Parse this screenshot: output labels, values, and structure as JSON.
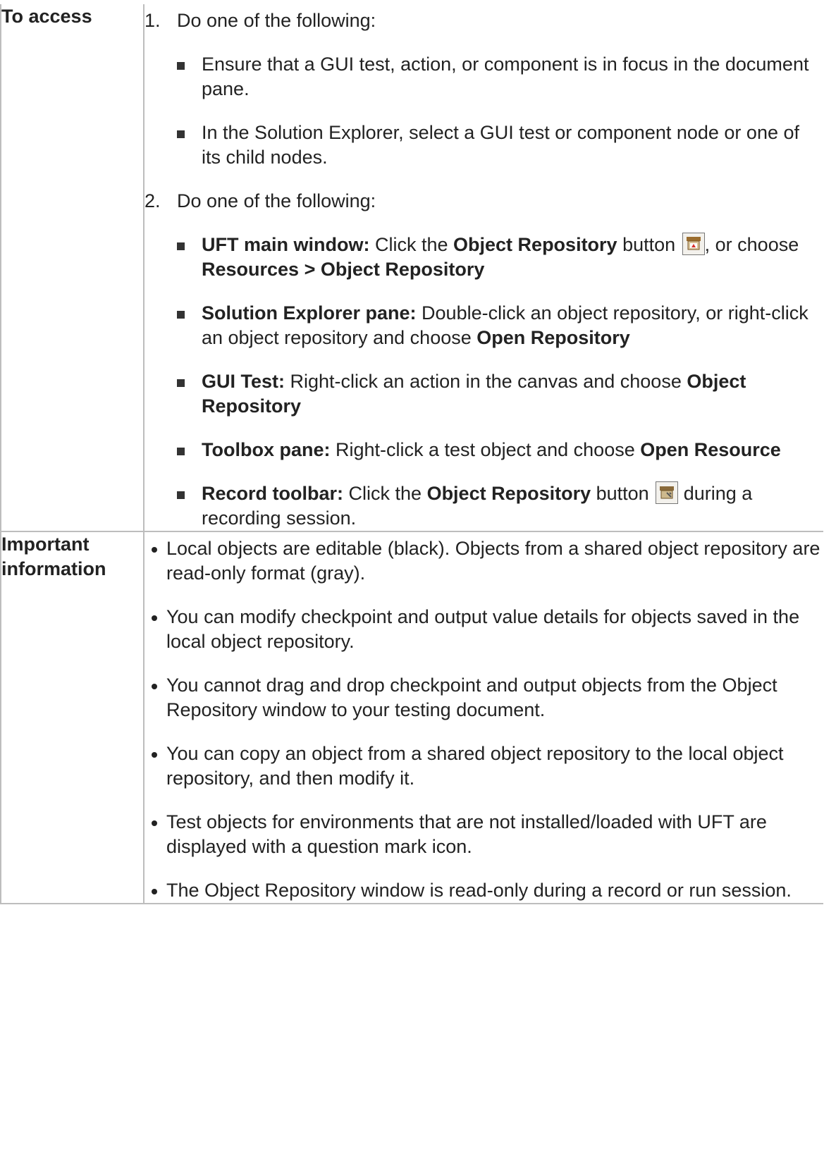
{
  "table": {
    "rows": [
      {
        "header": "To access",
        "steps": [
          {
            "number": "1.",
            "title": "Do one of the following:",
            "items": [
              {
                "text": "Ensure that a GUI test, action, or component is in focus in the document pane."
              },
              {
                "text": "In the Solution Explorer, select a GUI test or component node or one of its child nodes."
              }
            ]
          },
          {
            "number": "2.",
            "title": "Do one of the following:",
            "items": [
              {
                "lead": "UFT main window:",
                "t1": " Click the ",
                "b1": "Object Repository",
                "t2": " button ",
                "icon": "object-repository-icon",
                "t3": ", or choose ",
                "b2": "Resources > Object Repository"
              },
              {
                "lead": "Solution Explorer pane:",
                "t1": " Double-click an object repository, or right-click an object repository and choose ",
                "b1": "Open Repository"
              },
              {
                "lead": "GUI Test:",
                "t1": " Right-click an action in the canvas and choose ",
                "b1": "Object Repository"
              },
              {
                "lead": "Toolbox pane:",
                "t1": " Right-click a test object and choose ",
                "b1": "Open Resource"
              },
              {
                "lead": "Record toolbar:",
                "t1": " Click the ",
                "b1": "Object Repository",
                "t2": " button ",
                "icon": "record-object-repository-icon",
                "t3": " during a recording session."
              }
            ]
          }
        ]
      },
      {
        "header": "Important information",
        "bullets": [
          "Local objects are editable (black). Objects from a shared object repository are read-only format (gray).",
          "You can modify checkpoint and output value details for objects saved in the local object repository.",
          "You cannot drag and drop checkpoint and output objects from the Object Repository window to your testing document.",
          "You can copy an object from a shared object repository to the local object repository, and then modify it.",
          "Test objects for environments that are not installed/loaded with UFT are displayed with a question mark icon.",
          "The Object Repository window is read-only during a record or run session."
        ]
      }
    ]
  }
}
